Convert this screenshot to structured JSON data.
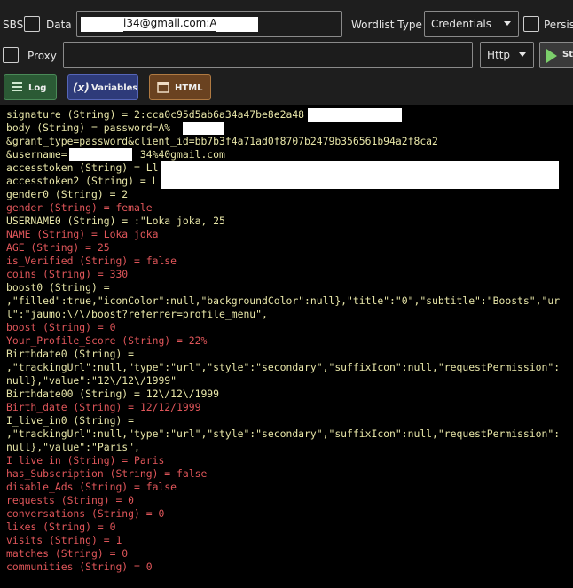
{
  "toolbar": {
    "sbs_label": "SBS",
    "data_label": "Data",
    "data_value": "i34@gmail.com:A@",
    "wordlist_label": "Wordlist Type",
    "wordlist_value": "Credentials",
    "persist_label": "Persist",
    "proxy_label": "Proxy",
    "proxy_value": "",
    "proxy_type": "Http",
    "start_label": "Sta"
  },
  "tabs": {
    "log": "Log",
    "variables": "Variables",
    "html": "HTML",
    "variables_icon": "(x)"
  },
  "log": {
    "lines": [
      "signature (String) = 2:cca0c95d5ab6a34a47be8e2a48",
      "body (String) = password=A%",
      "&grant_type=password&client_id=bb7b3f4a71ad0f8707b2479b356561b94a2f8ca2",
      "&username=            34%40gmail.com",
      "accesstoken (String) = Ll",
      "accesstoken2 (String) = L",
      "gender0 (String) = 2",
      "gender (String) = female",
      "USERNAME0 (String) = :\"Loka joka, 25",
      "NAME (String) = Loka joka",
      "AGE (String) = 25",
      "is_Verified (String) = false",
      "coins (String) = 330",
      "boost0 (String) =",
      ",\"filled\":true,\"iconColor\":null,\"backgroundColor\":null},\"title\":\"0\",\"subtitle\":\"Boosts\",\"ur",
      "l\":\"jaumo:\\/\\/boost?referrer=profile_menu\",",
      "boost (String) = 0",
      "Your_Profile_Score (String) = 22%",
      "Birthdate0 (String) =",
      ",\"trackingUrl\":null,\"type\":\"url\",\"style\":\"secondary\",\"suffixIcon\":null,\"requestPermission\":",
      "null},\"value\":\"12\\/12\\/1999\"",
      "Birthdate00 (String) = 12\\/12\\/1999",
      "Birth_date (String) = 12/12/1999",
      "I_live_in0 (String) =",
      ",\"trackingUrl\":null,\"type\":\"url\",\"style\":\"secondary\",\"suffixIcon\":null,\"requestPermission\":",
      "null},\"value\":\"Paris\",",
      "I_live_in (String) = Paris",
      "has_Subscription (String) = false",
      "disable_Ads (String) = false",
      "requests (String) = 0",
      "conversations (String) = 0",
      "likes (String) = 0",
      "visits (String) = 1",
      "matches (String) = 0",
      "communities (String) = 0"
    ]
  },
  "colors": {
    "variable_yellow": "#e8e6a8",
    "captured_red": "#e0565a",
    "log_background": "#000000"
  }
}
